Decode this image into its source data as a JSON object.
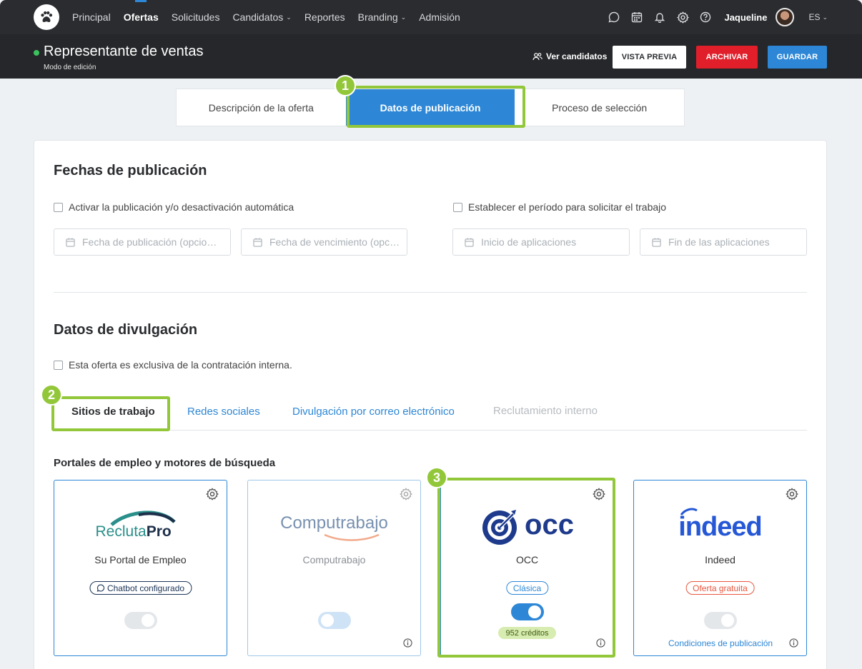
{
  "nav": {
    "items": [
      {
        "label": "Principal",
        "active": false,
        "dropdown": false
      },
      {
        "label": "Ofertas",
        "active": true,
        "dropdown": false
      },
      {
        "label": "Solicitudes",
        "active": false,
        "dropdown": false
      },
      {
        "label": "Candidatos",
        "active": false,
        "dropdown": true
      },
      {
        "label": "Reportes",
        "active": false,
        "dropdown": false
      },
      {
        "label": "Branding",
        "active": false,
        "dropdown": true
      },
      {
        "label": "Admisión",
        "active": false,
        "dropdown": false
      }
    ],
    "user_name": "Jaqueline",
    "lang": "ES"
  },
  "header": {
    "title": "Representante de ventas",
    "mode": "Modo de edición",
    "view_candidates": "Ver candidatos",
    "preview": "VISTA PREVIA",
    "archive": "ARCHIVAR",
    "save": "GUARDAR"
  },
  "steps": [
    {
      "label": "Descripción de la oferta"
    },
    {
      "label": "Datos de publicación"
    },
    {
      "label": "Proceso de selección"
    }
  ],
  "badges": {
    "one": "1",
    "two": "2",
    "three": "3"
  },
  "fechas": {
    "title": "Fechas de publicación",
    "auto_label": "Activar la publicación y/o desactivación automática",
    "period_label": "Establecer el período para solicitar el trabajo",
    "pub_placeholder": "Fecha de publicación (opcio…",
    "exp_placeholder": "Fecha de vencimiento (opc…",
    "start_placeholder": "Inicio de aplicaciones",
    "end_placeholder": "Fin de las aplicaciones"
  },
  "divulgacion": {
    "title": "Datos de divulgación",
    "internal_label": "Esta oferta es exclusiva de la contratación interna.",
    "tabs": [
      {
        "label": "Sitios de trabajo"
      },
      {
        "label": "Redes sociales"
      },
      {
        "label": "Divulgación por correo electrónico"
      },
      {
        "label": "Reclutamiento interno"
      }
    ],
    "section_label": "Portales de empleo y motores de búsqueda"
  },
  "portals": [
    {
      "logo_text": "ReclutaPro",
      "logo_a": "Recluta",
      "logo_b": "Pro",
      "name": "Su Portal de Empleo",
      "pill": "Chatbot configurado"
    },
    {
      "logo_text": "Computrabajo",
      "name": "Computrabajo"
    },
    {
      "logo_text": "occ",
      "name": "OCC",
      "pill": "Clásica",
      "credits": "952 créditos"
    },
    {
      "logo_text": "indeed",
      "name": "Indeed",
      "pill": "Oferta gratuita",
      "link": "Condiciones de publicación"
    }
  ],
  "colors": {
    "accent": "#2d87d6",
    "highlight": "#93c73a",
    "danger": "#e11f2a",
    "topbar": "#2a2c2f"
  }
}
